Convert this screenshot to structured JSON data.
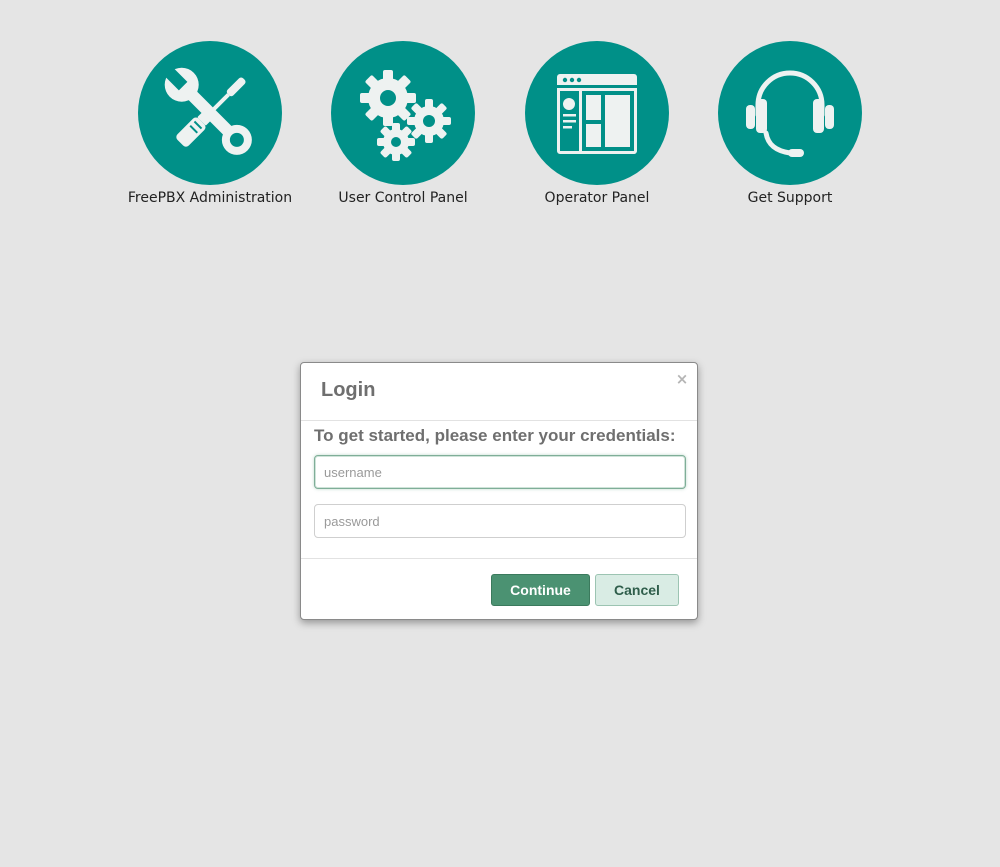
{
  "tiles": [
    {
      "label": "FreePBX Administration",
      "icon": "tools-icon"
    },
    {
      "label": "User Control Panel",
      "icon": "gears-icon"
    },
    {
      "label": "Operator Panel",
      "icon": "panel-layout-icon"
    },
    {
      "label": "Get Support",
      "icon": "headset-icon"
    }
  ],
  "login_dialog": {
    "title": "Login",
    "close_glyph": "×",
    "instructions": "To get started, please enter your credentials:",
    "username_placeholder": "username",
    "username_value": "",
    "password_placeholder": "password",
    "password_value": "",
    "continue_label": "Continue",
    "cancel_label": "Cancel"
  },
  "colors": {
    "page_background": "#e5e5e5",
    "tile_circle": "#009088",
    "continue_button": "#4b9272",
    "cancel_button": "#d9ece4"
  }
}
